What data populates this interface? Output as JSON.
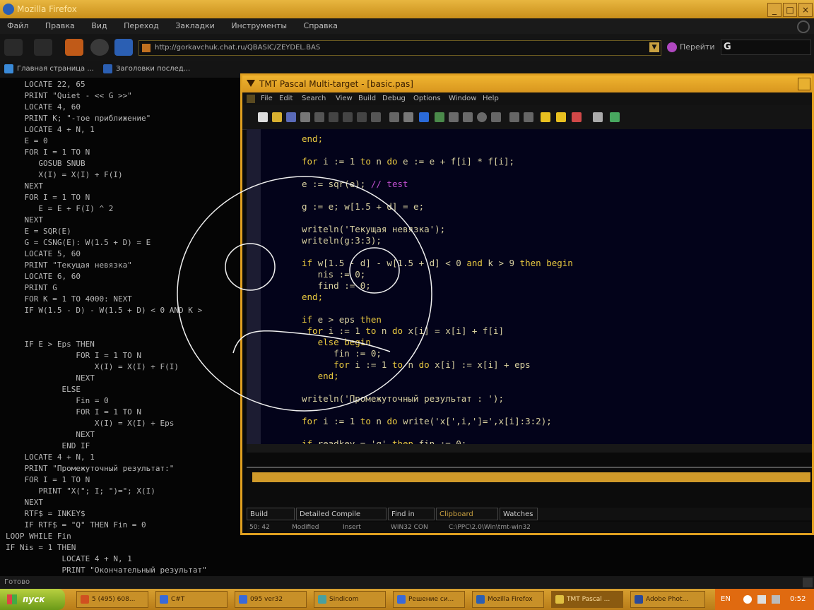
{
  "browser": {
    "title": "Mozilla Firefox",
    "menu": [
      "Файл",
      "Правка",
      "Вид",
      "Переход",
      "Закладки",
      "Инструменты",
      "Справка"
    ],
    "url": "http://gorkavchuk.chat.ru/QBASIC/ZEYDEL.BAS",
    "go_label": "Перейти",
    "search_logo": "G",
    "bookmarks": [
      "Главная страница ...",
      "Заголовки послед..."
    ],
    "status": "Готово"
  },
  "basic_code": "    LOCATE 22, 65\n    PRINT \"Quiet - << G >>\"\n    LOCATE 4, 60\n    PRINT K; \"-тое приближение\"\n    LOCATE 4 + N, 1\n    E = 0\n    FOR I = 1 TO N\n       GOSUB SNUB\n       X(I) = X(I) + F(I)\n    NEXT\n    FOR I = 1 TO N\n       E = E + F(I) ^ 2\n    NEXT\n    E = SQR(E)\n    G = CSNG(E): W(1.5 + D) = E\n    LOCATE 5, 60\n    PRINT \"Текущая невязка\"\n    LOCATE 6, 60\n    PRINT G\n    FOR K = 1 TO 4000: NEXT\n    IF W(1.5 - D) - W(1.5 + D) < 0 AND K >\n\n\n    IF E > Eps THEN\n               FOR I = 1 TO N\n                   X(I) = X(I) + F(I)\n               NEXT\n            ELSE\n               Fin = 0\n               FOR I = 1 TO N\n                   X(I) = X(I) + Eps\n               NEXT\n            END IF\n    LOCATE 4 + N, 1\n    PRINT \"Промежуточный результат:\"\n    FOR I = 1 TO N\n       PRINT \"X(\"; I; \")=\"; X(I)\n    NEXT\n    RTF$ = INKEY$\n    IF RTF$ = \"Q\" THEN Fin = 0\nLOOP WHILE Fin\nIF Nis = 1 THEN\n            LOCATE 4 + N, 1\n            PRINT \"Окончательный результат\"",
  "ide": {
    "title": "TMT Pascal Multi-target - [basic.pas]",
    "menu": [
      "File",
      "Edit",
      "Search",
      "View",
      "Build",
      "Debug",
      "Options",
      "Window",
      "Help"
    ],
    "code_lines": [
      [
        {
          "t": "end;",
          "c": "kw"
        }
      ],
      [],
      [
        {
          "t": "for",
          "c": "kw"
        },
        {
          "t": " i := 1 ",
          "c": ""
        },
        {
          "t": "to",
          "c": "kw"
        },
        {
          "t": " n ",
          "c": ""
        },
        {
          "t": "do",
          "c": "kw"
        },
        {
          "t": " e := e + f[i] * f[i];",
          "c": ""
        }
      ],
      [],
      [
        {
          "t": "e := sqr(e); ",
          "c": ""
        },
        {
          "t": "// test",
          "c": "cm"
        }
      ],
      [],
      [
        {
          "t": "g := e; w[1.5 + d] = e;",
          "c": ""
        }
      ],
      [],
      [
        {
          "t": "writeln('Текущая невязка');",
          "c": ""
        }
      ],
      [
        {
          "t": "writeln(g:3:3);",
          "c": ""
        }
      ],
      [],
      [
        {
          "t": "if",
          "c": "kw"
        },
        {
          "t": " w[1.5 - d] - w[1.5 + d] < 0 ",
          "c": ""
        },
        {
          "t": "and",
          "c": "kw"
        },
        {
          "t": " k > 9 ",
          "c": ""
        },
        {
          "t": "then begin",
          "c": "kw"
        }
      ],
      [
        {
          "t": "   nis := 0;",
          "c": ""
        }
      ],
      [
        {
          "t": "   find := 0;",
          "c": ""
        }
      ],
      [
        {
          "t": "end;",
          "c": "kw"
        }
      ],
      [],
      [
        {
          "t": "if",
          "c": "kw"
        },
        {
          "t": " e > eps ",
          "c": ""
        },
        {
          "t": "then",
          "c": "kw"
        }
      ],
      [
        {
          "t": " for",
          "c": "kw"
        },
        {
          "t": " i := 1 ",
          "c": ""
        },
        {
          "t": "to",
          "c": "kw"
        },
        {
          "t": " n ",
          "c": ""
        },
        {
          "t": "do",
          "c": "kw"
        },
        {
          "t": " x[i] = x[i] + f[i]",
          "c": ""
        }
      ],
      [
        {
          "t": "   else begin",
          "c": "kw"
        }
      ],
      [
        {
          "t": "      fin := 0;",
          "c": ""
        }
      ],
      [
        {
          "t": "      for",
          "c": "kw"
        },
        {
          "t": " i := 1 ",
          "c": ""
        },
        {
          "t": "to",
          "c": "kw"
        },
        {
          "t": " n ",
          "c": ""
        },
        {
          "t": "do",
          "c": "kw"
        },
        {
          "t": " x[i] := x[i] + eps",
          "c": ""
        }
      ],
      [
        {
          "t": "   end;",
          "c": "kw"
        }
      ],
      [],
      [
        {
          "t": "writeln('Промежуточный результат : ');",
          "c": ""
        }
      ],
      [],
      [
        {
          "t": "for",
          "c": "kw"
        },
        {
          "t": " i := 1 ",
          "c": ""
        },
        {
          "t": "to",
          "c": "kw"
        },
        {
          "t": " n ",
          "c": ""
        },
        {
          "t": "do",
          "c": "kw"
        },
        {
          "t": " write('x[',i,']=',x[i]:3:2);",
          "c": ""
        }
      ],
      [],
      [
        {
          "t": "if",
          "c": "kw"
        },
        {
          "t": " readkey = 'q' ",
          "c": ""
        },
        {
          "t": "then",
          "c": "kw"
        },
        {
          "t": " fin := 0;",
          "c": ""
        }
      ]
    ],
    "tabs": [
      "Build Debug",
      "Detailed Compile Report",
      "Find in Files",
      "Clipboard History",
      "Watches"
    ],
    "status": {
      "position": "50: 42",
      "modified": "Modified",
      "mode": "Insert",
      "encoding": "WIN32 CON",
      "path": "C:\\PPC\\2.0\\Win\\tmt-win32"
    }
  },
  "taskbar": {
    "start_label": "пуск",
    "tasks": [
      "5 (495) 608...",
      "C#T",
      "095 ver32",
      "Sindicom",
      "Решение си...",
      "Mozilla Firefox",
      "TMT Pascal ...",
      "Adobe Phot..."
    ],
    "lang": "EN",
    "clock": "0:52"
  },
  "colors": {
    "accent": "#e0a020",
    "keyword": "#e8c840",
    "comment": "#c050d0",
    "start_button": "#7aa820"
  }
}
